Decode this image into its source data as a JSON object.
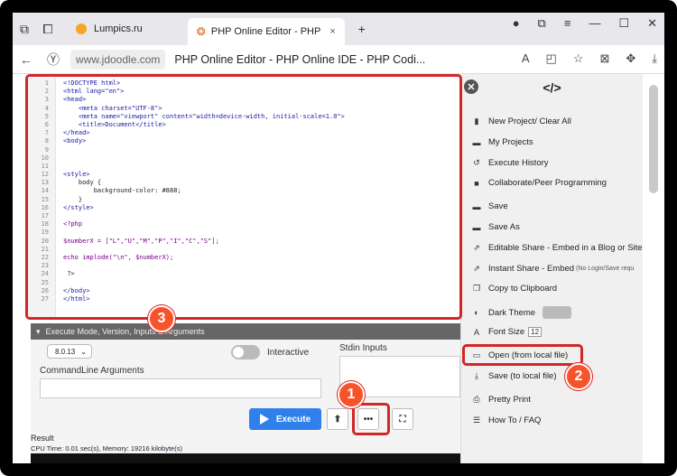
{
  "browser": {
    "tabs": [
      {
        "label": "Lumpics.ru"
      },
      {
        "label": "PHP Online Editor - PHP",
        "close": "×"
      }
    ],
    "new_tab": "+",
    "domain": "www.jdoodle.com",
    "page_title": "PHP Online Editor - PHP Online IDE - PHP Codi..."
  },
  "editor": {
    "lines": [
      {
        "n": "1",
        "text": "<!DOCTYPE html>"
      },
      {
        "n": "2",
        "text": "<html lang=\"en\">"
      },
      {
        "n": "3",
        "text": "<head>"
      },
      {
        "n": "4",
        "text": "    <meta charset=\"UTF-8\">"
      },
      {
        "n": "5",
        "text": "    <meta name=\"viewport\" content=\"width=device-width, initial-scale=1.0\">"
      },
      {
        "n": "6",
        "text": "    <title>Document</title>"
      },
      {
        "n": "7",
        "text": "</head>"
      },
      {
        "n": "8",
        "text": "<body>"
      },
      {
        "n": "9",
        "text": ""
      },
      {
        "n": "10",
        "text": ""
      },
      {
        "n": "11",
        "text": ""
      },
      {
        "n": "12",
        "text": "<style>"
      },
      {
        "n": "13",
        "text": "    body {"
      },
      {
        "n": "14",
        "text": "        background-color: #888;"
      },
      {
        "n": "15",
        "text": "    }"
      },
      {
        "n": "16",
        "text": "</style>"
      },
      {
        "n": "17",
        "text": ""
      },
      {
        "n": "18",
        "text": "<?php"
      },
      {
        "n": "19",
        "text": ""
      },
      {
        "n": "20",
        "text": "$numberX = [\"L\",\"U\",\"M\",\"P\",\"I\",\"C\",\"S\"];"
      },
      {
        "n": "21",
        "text": ""
      },
      {
        "n": "22",
        "text": "echo implode(\"\\n\", $numberX);"
      },
      {
        "n": "23",
        "text": ""
      },
      {
        "n": "24",
        "text": " ?>"
      },
      {
        "n": "25",
        "text": ""
      },
      {
        "n": "26",
        "text": "</body>"
      },
      {
        "n": "27",
        "text": "</html>"
      }
    ]
  },
  "execute_panel": {
    "header": "Execute Mode, Version, Inputs & Arguments",
    "version": "8.0.13",
    "interactive_label": "Interactive",
    "stdin_label": "Stdin Inputs",
    "cmdline_label": "CommandLine Arguments",
    "execute_label": "Execute",
    "more_label": "•••",
    "result_label": "Result",
    "cpu_text": "CPU Time: 0.01 sec(s), Memory: 19216 kilobyte(s)"
  },
  "sidebar": {
    "logo": "</>",
    "items": [
      {
        "label": "New Project/ Clear All",
        "icon": "file-icon"
      },
      {
        "label": "My Projects",
        "icon": "folder-icon"
      },
      {
        "label": "Execute History",
        "icon": "history-icon"
      },
      {
        "label": "Collaborate/Peer Programming",
        "icon": "video-icon"
      },
      {
        "label": "Save",
        "icon": "folder-icon"
      },
      {
        "label": "Save As",
        "icon": "folder-icon"
      },
      {
        "label": "Editable Share - Embed in a Blog or Site",
        "icon": "share-icon"
      },
      {
        "label": "Instant Share - Embed",
        "note": "(No Login/Save requ",
        "icon": "share-icon"
      },
      {
        "label": "Copy to Clipboard",
        "icon": "copy-icon"
      },
      {
        "label": "Dark Theme",
        "icon": "moon-icon"
      },
      {
        "label": "Font Size",
        "value": "12",
        "icon": "font-icon"
      },
      {
        "label": "Open (from local file)",
        "icon": "folder-open-icon"
      },
      {
        "label": "Save (to local file)",
        "icon": "download-icon"
      },
      {
        "label": "Pretty Print",
        "icon": "print-icon"
      },
      {
        "label": "How To / FAQ",
        "icon": "list-icon"
      }
    ]
  },
  "badges": {
    "one": "1",
    "two": "2",
    "three": "3"
  }
}
